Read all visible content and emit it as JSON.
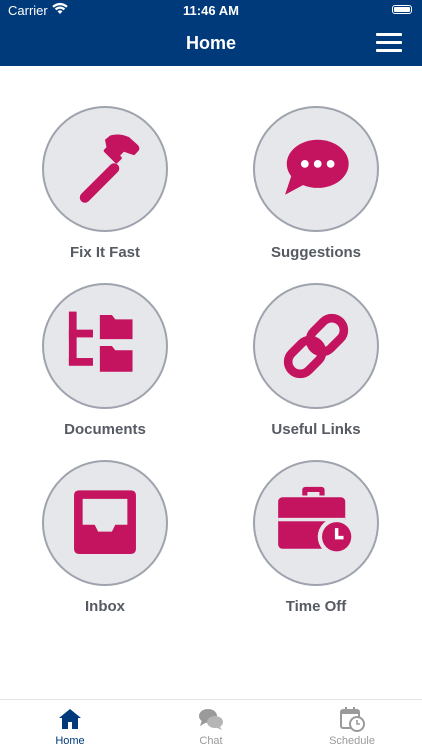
{
  "status_bar": {
    "carrier": "Carrier",
    "time": "11:46 AM"
  },
  "header": {
    "title": "Home",
    "menu_icon": "hamburger-menu-icon"
  },
  "tiles": [
    {
      "label": "Fix It Fast",
      "icon": "hammer-icon"
    },
    {
      "label": "Suggestions",
      "icon": "speech-bubble-icon"
    },
    {
      "label": "Documents",
      "icon": "folder-tree-icon"
    },
    {
      "label": "Useful Links",
      "icon": "link-icon"
    },
    {
      "label": "Inbox",
      "icon": "inbox-tray-icon"
    },
    {
      "label": "Time Off",
      "icon": "briefcase-clock-icon"
    }
  ],
  "tabbar": {
    "items": [
      {
        "label": "Home",
        "icon": "house-icon",
        "active": true
      },
      {
        "label": "Chat",
        "icon": "chat-bubbles-icon",
        "active": false
      },
      {
        "label": "Schedule",
        "icon": "calendar-clock-icon",
        "active": false
      }
    ]
  },
  "colors": {
    "header_bg": "#003a7a",
    "icon_accent": "#c4135f",
    "circle_bg": "#e6e7ea",
    "circle_border": "#9ea3ad",
    "label_text": "#555a63",
    "tab_active": "#003a7a",
    "tab_inactive": "#9a9a9a"
  }
}
